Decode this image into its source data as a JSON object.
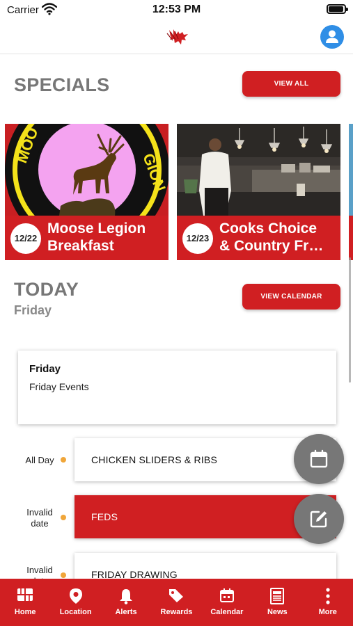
{
  "status_bar": {
    "carrier": "Carrier",
    "time": "12:53 PM"
  },
  "header": {
    "logo": "moose-logo-icon",
    "profile": "user-icon"
  },
  "specials": {
    "title": "SPECIALS",
    "view_all_label": "VIEW ALL",
    "cards": [
      {
        "date": "12/22",
        "title": "Moose Legion\nBreakfast",
        "image": "moose-legion-emblem"
      },
      {
        "date": "12/23",
        "title": "Cooks Choice\n& Country Fr…",
        "image": "kitchen-photo"
      }
    ]
  },
  "today": {
    "title": "TODAY",
    "day": "Friday",
    "view_calendar_label": "VIEW CALENDAR",
    "summary": {
      "title": "Friday",
      "text": "Friday Events"
    },
    "events": [
      {
        "time": "All Day",
        "label": "CHICKEN SLIDERS & RIBS",
        "highlighted": false
      },
      {
        "time": "Invalid date",
        "label": "FEDS",
        "highlighted": true
      },
      {
        "time": "Invalid date",
        "label": "FRIDAY DRAWING",
        "highlighted": false
      }
    ]
  },
  "fabs": [
    "calendar-icon",
    "edit-icon"
  ],
  "tabs": [
    {
      "label": "Home",
      "icon": "home-grid-icon"
    },
    {
      "label": "Location",
      "icon": "map-pin-icon"
    },
    {
      "label": "Alerts",
      "icon": "bell-icon"
    },
    {
      "label": "Rewards",
      "icon": "tag-icon"
    },
    {
      "label": "Calendar",
      "icon": "calendar-icon"
    },
    {
      "label": "News",
      "icon": "newspaper-icon"
    },
    {
      "label": "More",
      "icon": "more-vertical-icon"
    }
  ],
  "colors": {
    "accent": "#d01f22",
    "profile_blue": "#2f8ee6",
    "dot": "#f0a63a",
    "fab": "#777777"
  }
}
